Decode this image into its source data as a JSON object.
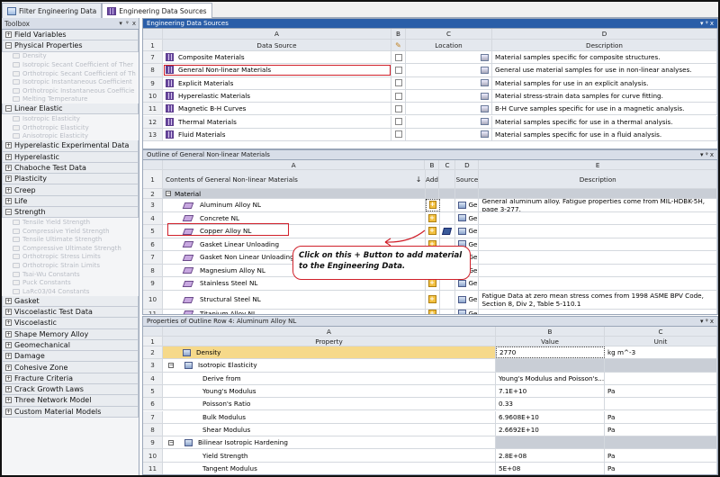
{
  "tabs": [
    {
      "label": "Filter Engineering Data"
    },
    {
      "label": "Engineering Data Sources"
    }
  ],
  "toolbox": {
    "title": "Toolbox",
    "controls": [
      "▾",
      "ᵠ",
      "x"
    ],
    "items": [
      {
        "type": "cat",
        "sign": "+",
        "label": "Field Variables"
      },
      {
        "type": "cat",
        "sign": "−",
        "label": "Physical Properties"
      },
      {
        "type": "sub",
        "label": "Density"
      },
      {
        "type": "sub",
        "label": "Isotropic Secant Coefficient of Ther"
      },
      {
        "type": "sub",
        "label": "Orthotropic Secant Coefficient of Th"
      },
      {
        "type": "sub",
        "label": "Isotropic Instantaneous Coefficient"
      },
      {
        "type": "sub",
        "label": "Orthotropic Instantaneous Coefficie"
      },
      {
        "type": "sub",
        "label": "Melting Temperature"
      },
      {
        "type": "cat",
        "sign": "−",
        "label": "Linear Elastic"
      },
      {
        "type": "sub",
        "label": "Isotropic Elasticity"
      },
      {
        "type": "sub",
        "label": "Orthotropic Elasticity"
      },
      {
        "type": "sub",
        "label": "Anisotropic Elasticity"
      },
      {
        "type": "cat",
        "sign": "+",
        "label": "Hyperelastic Experimental Data"
      },
      {
        "type": "cat",
        "sign": "+",
        "label": "Hyperelastic"
      },
      {
        "type": "cat",
        "sign": "+",
        "label": "Chaboche Test Data"
      },
      {
        "type": "cat",
        "sign": "+",
        "label": "Plasticity"
      },
      {
        "type": "cat",
        "sign": "+",
        "label": "Creep"
      },
      {
        "type": "cat",
        "sign": "+",
        "label": "Life"
      },
      {
        "type": "cat",
        "sign": "−",
        "label": "Strength"
      },
      {
        "type": "sub",
        "label": "Tensile Yield Strength"
      },
      {
        "type": "sub",
        "label": "Compressive Yield Strength"
      },
      {
        "type": "sub",
        "label": "Tensile Ultimate Strength"
      },
      {
        "type": "sub",
        "label": "Compressive Ultimate Strength"
      },
      {
        "type": "sub",
        "label": "Orthotropic Stress Limits"
      },
      {
        "type": "sub",
        "label": "Orthotropic Strain Limits"
      },
      {
        "type": "sub",
        "label": "Tsai-Wu Constants"
      },
      {
        "type": "sub",
        "label": "Puck Constants"
      },
      {
        "type": "sub",
        "label": "LaRc03/04 Constants"
      },
      {
        "type": "cat",
        "sign": "+",
        "label": "Gasket"
      },
      {
        "type": "cat",
        "sign": "+",
        "label": "Viscoelastic Test Data"
      },
      {
        "type": "cat",
        "sign": "+",
        "label": "Viscoelastic"
      },
      {
        "type": "cat",
        "sign": "+",
        "label": "Shape Memory Alloy"
      },
      {
        "type": "cat",
        "sign": "+",
        "label": "Geomechanical"
      },
      {
        "type": "cat",
        "sign": "+",
        "label": "Damage"
      },
      {
        "type": "cat",
        "sign": "+",
        "label": "Cohesive Zone"
      },
      {
        "type": "cat",
        "sign": "+",
        "label": "Fracture Criteria"
      },
      {
        "type": "cat",
        "sign": "+",
        "label": "Crack Growth Laws"
      },
      {
        "type": "cat",
        "sign": "+",
        "label": "Three Network Model"
      },
      {
        "type": "cat",
        "sign": "+",
        "label": "Custom Material Models"
      }
    ]
  },
  "sources": {
    "title": "Engineering Data Sources",
    "controls": "▾ ᵠ x",
    "cols": {
      "A": "A",
      "B": "B",
      "C": "C",
      "D": "D"
    },
    "header": {
      "num": "1",
      "source": "Data Source",
      "location": "Location",
      "description": "Description"
    },
    "rows": [
      {
        "num": "7",
        "name": "Composite Materials",
        "desc": "Material samples specific for composite structures."
      },
      {
        "num": "8",
        "name": "General Non-linear Materials",
        "desc": "General use material samples for use in non-linear analyses."
      },
      {
        "num": "9",
        "name": "Explicit Materials",
        "desc": "Material samples for use in an explicit analysis."
      },
      {
        "num": "10",
        "name": "Hyperelastic Materials",
        "desc": "Material stress-strain data samples for curve fitting."
      },
      {
        "num": "11",
        "name": "Magnetic B-H Curves",
        "desc": "B-H Curve samples specific for use in a magnetic analysis."
      },
      {
        "num": "12",
        "name": "Thermal Materials",
        "desc": "Material samples specific for use in a thermal analysis."
      },
      {
        "num": "13",
        "name": "Fluid Materials",
        "desc": "Material samples specific for use in a fluid analysis."
      }
    ]
  },
  "outline": {
    "title": "Outline of General Non-linear Materials",
    "controls": "▾ ᵠ x",
    "cols": {
      "A": "A",
      "B": "B",
      "C": "C",
      "D": "D",
      "E": "E"
    },
    "header": {
      "num": "1",
      "contents": "Contents of General Non-linear Materials",
      "add": "Add",
      "source": "Source",
      "description": "Description"
    },
    "group": {
      "num": "2",
      "label": "Material"
    },
    "rows": [
      {
        "num": "3",
        "name": "Aluminum Alloy NL",
        "src": "Gen",
        "desc": "General aluminum alloy. Fatigue properties come from MIL-HDBK-5H, page 3-277."
      },
      {
        "num": "4",
        "name": "Concrete NL",
        "src": "Gen",
        "desc": ""
      },
      {
        "num": "5",
        "name": "Copper Alloy NL",
        "src": "Gen",
        "desc": ""
      },
      {
        "num": "6",
        "name": "Gasket Linear Unloading",
        "src": "Gen",
        "desc": ""
      },
      {
        "num": "7",
        "name": "Gasket Non Linear Unloading",
        "src": "Gen",
        "desc": ""
      },
      {
        "num": "8",
        "name": "Magnesium Alloy NL",
        "src": "Gen",
        "desc": ""
      },
      {
        "num": "9",
        "name": "Stainless Steel NL",
        "src": "Gen",
        "desc": ""
      },
      {
        "num": "10",
        "name": "Structural Steel NL",
        "src": "Gen",
        "desc": "Fatigue Data at zero mean stress comes from 1998 ASME BPV Code, Section 8, Div 2, Table 5-110.1"
      },
      {
        "num": "11",
        "name": "Titanium Alloy NL",
        "src": "Gen",
        "desc": ""
      }
    ],
    "callout": "Click on this + Button to add material to the Engineering Data."
  },
  "properties": {
    "title": "Properties of Outline Row 4: Aluminum Alloy NL",
    "controls": "▾ ᵠ x",
    "cols": {
      "A": "A",
      "B": "B",
      "C": "C"
    },
    "header": {
      "num": "1",
      "property": "Property",
      "value": "Value",
      "unit": "Unit"
    },
    "rows": [
      {
        "num": "2",
        "sign": "",
        "name": "Density",
        "value": "2770",
        "unit": "kg m^-3",
        "indent": 1,
        "icon": true
      },
      {
        "num": "3",
        "sign": "−",
        "name": "Isotropic Elasticity",
        "value": "",
        "unit": "",
        "indent": 0,
        "icon": true
      },
      {
        "num": "4",
        "sign": "",
        "name": "Derive from",
        "value": "Young's Modulus and Poisson's...",
        "unit": "",
        "indent": 2,
        "icon": false
      },
      {
        "num": "5",
        "sign": "",
        "name": "Young's Modulus",
        "value": "7.1E+10",
        "unit": "Pa",
        "indent": 2,
        "icon": false
      },
      {
        "num": "6",
        "sign": "",
        "name": "Poisson's Ratio",
        "value": "0.33",
        "unit": "",
        "indent": 2,
        "icon": false
      },
      {
        "num": "7",
        "sign": "",
        "name": "Bulk Modulus",
        "value": "6.9608E+10",
        "unit": "Pa",
        "indent": 2,
        "icon": false
      },
      {
        "num": "8",
        "sign": "",
        "name": "Shear Modulus",
        "value": "2.6692E+10",
        "unit": "Pa",
        "indent": 2,
        "icon": false
      },
      {
        "num": "9",
        "sign": "−",
        "name": "Bilinear Isotropic Hardening",
        "value": "",
        "unit": "",
        "indent": 0,
        "icon": true
      },
      {
        "num": "10",
        "sign": "",
        "name": "Yield Strength",
        "value": "2.8E+08",
        "unit": "Pa",
        "indent": 2,
        "icon": false
      },
      {
        "num": "11",
        "sign": "",
        "name": "Tangent Modulus",
        "value": "5E+08",
        "unit": "Pa",
        "indent": 2,
        "icon": false
      }
    ]
  },
  "colors": {
    "accent_red": "#d0202a",
    "selected_row": "#f6d98a"
  }
}
